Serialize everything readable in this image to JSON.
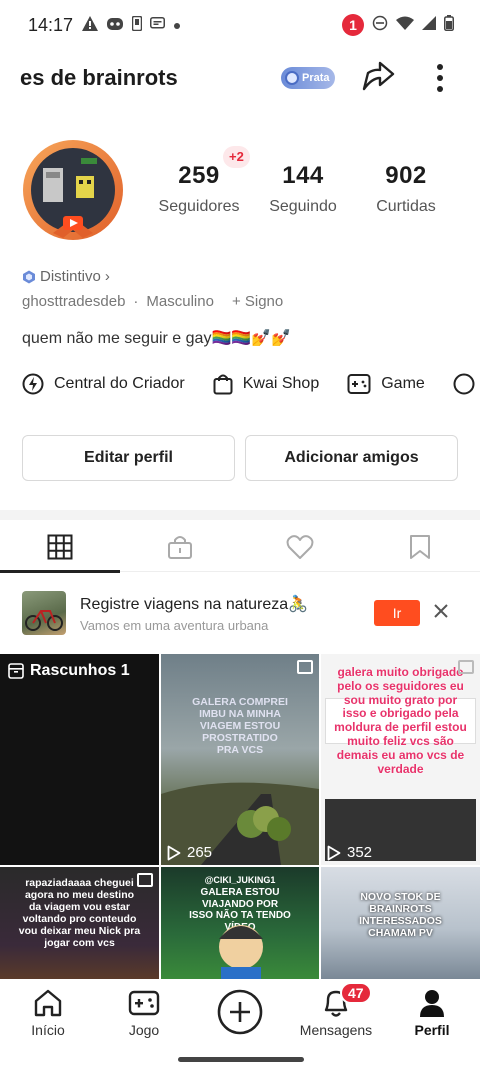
{
  "status_bar": {
    "time": "14:17",
    "notification_count": "1",
    "icons_left": [
      "warning-icon",
      "discord-icon",
      "phone-icon",
      "message-icon",
      "dot-icon"
    ],
    "icons_right": [
      "dnd-icon",
      "wifi-icon",
      "signal-icon",
      "battery-icon"
    ]
  },
  "header": {
    "title": "es de brainrots",
    "badge_label": "Prata"
  },
  "profile": {
    "followers_plus": "+2",
    "stats": [
      {
        "value": "259",
        "label": "Seguidores"
      },
      {
        "value": "144",
        "label": "Seguindo"
      },
      {
        "value": "902",
        "label": "Curtidas"
      }
    ],
    "distintivo": "Distintivo",
    "distintivo_arrow": "›",
    "username": "ghosttradesdeb",
    "separator": "·",
    "gender": "Masculino",
    "sign": "+ Signo",
    "bio": "quem não me seguir e gay🏳️‍🌈🏳️‍🌈💅💅"
  },
  "links": [
    {
      "label": "Central do Criador",
      "icon": "lightning-icon"
    },
    {
      "label": "Kwai Shop",
      "icon": "shopping-bag-icon"
    },
    {
      "label": "Game",
      "icon": "gamepad-icon"
    }
  ],
  "buttons": {
    "edit_profile": "Editar perfil",
    "add_friends": "Adicionar amigos"
  },
  "tabs": [
    {
      "icon": "grid-icon",
      "active": true
    },
    {
      "icon": "lock-icon",
      "active": false
    },
    {
      "icon": "heart-icon",
      "active": false
    },
    {
      "icon": "bookmark-icon",
      "active": false
    }
  ],
  "promo": {
    "title": "Registre viagens na natureza🚴",
    "subtitle": "Vamos em uma aventura urbana",
    "button": "Ir"
  },
  "grid": {
    "drafts_label": "Rascunhos 1",
    "videos": [
      {
        "text": "GALERA COMPREI IMBU NA MINHA VIAGEM ESTOU PROSTRATIDO PRA VCS",
        "views": "265"
      },
      {
        "text": "galera muito obrigado pelo os seguidores eu sou muito grato por isso e obrigado pela moldura de perfil estou muito feliz vcs são demais eu amo vcs de verdade",
        "views": "352"
      },
      {
        "text": "rapaziadaaaa cheguei agora no meu destino da viagem vou estar voltando pro conteudo vou deixar meu Nick pra jogar com vcs"
      },
      {
        "text": "GALERA ESTOU VIAJANDO POR ISSO NÃO TA TENDO VÍDEO",
        "handle": "@CIKI_JUKING1"
      },
      {
        "text": "NOVO STOK DE BRAINROTS INTERESSADOS CHAMAM PV"
      }
    ]
  },
  "bottom_nav": {
    "items": [
      {
        "label": "Início",
        "icon": "home-icon"
      },
      {
        "label": "Jogo",
        "icon": "gamepad-icon"
      },
      {
        "label": "",
        "icon": "create-plus-icon"
      },
      {
        "label": "Mensagens",
        "icon": "bell-icon"
      },
      {
        "label": "Perfil",
        "icon": "person-icon"
      }
    ],
    "messages_badge": "47"
  },
  "colors": {
    "accent_red": "#e5293b",
    "promo_orange": "#ff4d1f",
    "pink_text": "#e8336b",
    "prata_blue": "#6a8bd8"
  }
}
